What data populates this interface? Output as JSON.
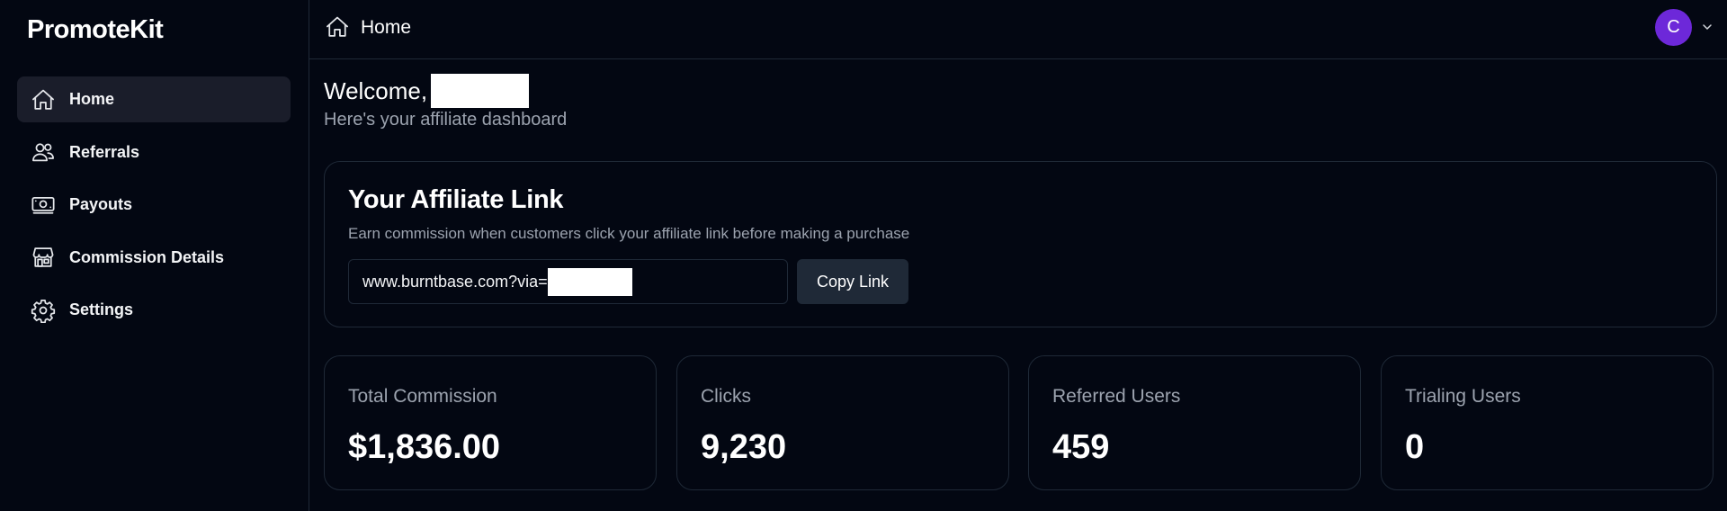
{
  "brand": "PromoteKit",
  "sidebar": {
    "items": [
      {
        "label": "Home",
        "icon": "home-icon",
        "active": true
      },
      {
        "label": "Referrals",
        "icon": "users-icon"
      },
      {
        "label": "Payouts",
        "icon": "cash-icon"
      },
      {
        "label": "Commission Details",
        "icon": "storefront-icon"
      },
      {
        "label": "Settings",
        "icon": "gear-icon"
      }
    ]
  },
  "header": {
    "title": "Home",
    "avatar_initial": "C",
    "avatar_color": "#6d28d9"
  },
  "welcome": {
    "greeting": "Welcome,",
    "subtitle": "Here's your affiliate dashboard"
  },
  "affiliate": {
    "title": "Your Affiliate Link",
    "description": "Earn commission when customers click your affiliate link before making a purchase",
    "link_prefix": "www.burntbase.com?via=",
    "copy_label": "Copy Link"
  },
  "stats": [
    {
      "label": "Total Commission",
      "value": "$1,836.00"
    },
    {
      "label": "Clicks",
      "value": "9,230"
    },
    {
      "label": "Referred Users",
      "value": "459"
    },
    {
      "label": "Trialing Users",
      "value": "0"
    }
  ]
}
